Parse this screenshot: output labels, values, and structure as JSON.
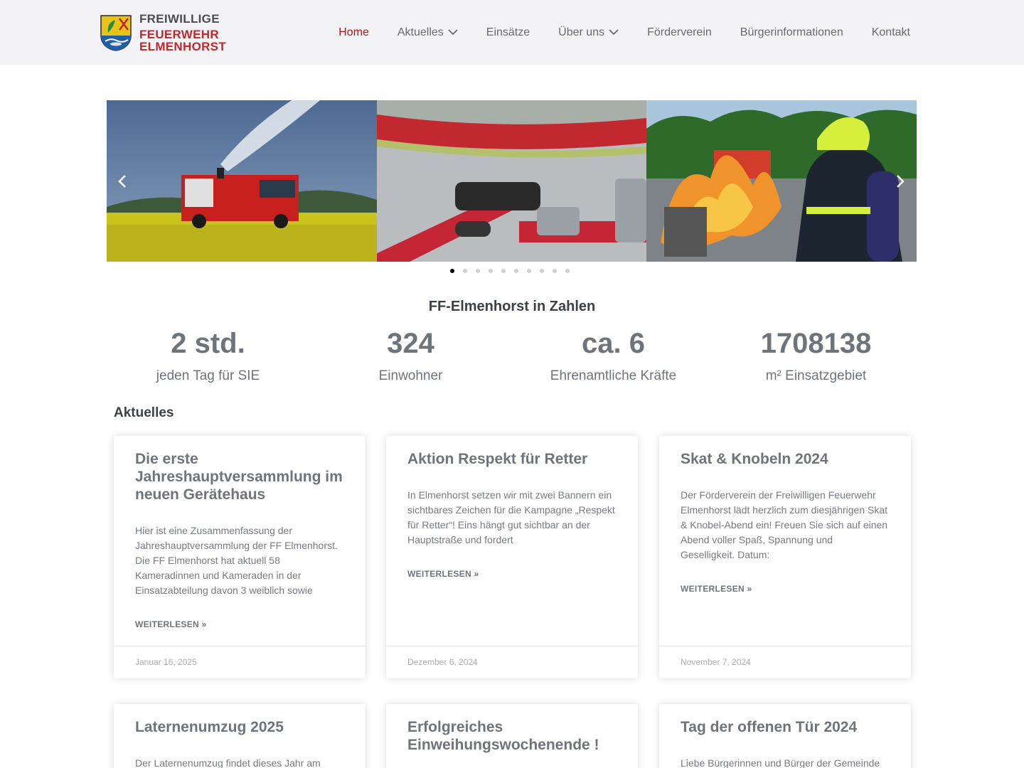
{
  "header": {
    "logo_line1": "FREIWILLIGE",
    "logo_line2": "FEUERWEHR ELMENHORST",
    "nav": [
      {
        "label": "Home",
        "active": true
      },
      {
        "label": "Aktuelles",
        "dropdown": true
      },
      {
        "label": "Einsätze"
      },
      {
        "label": "Über uns",
        "dropdown": true
      },
      {
        "label": "Förderverein"
      },
      {
        "label": "Bürgerinformationen"
      },
      {
        "label": "Kontakt"
      }
    ]
  },
  "slider": {
    "slides": [
      "fire-truck-in-field",
      "fire-hose-nozzle",
      "firefighter-at-fire-training"
    ],
    "dot_count": 10,
    "active_dot": 0
  },
  "stats": {
    "title": "FF-Elmenhorst in Zahlen",
    "items": [
      {
        "value": "2 std.",
        "label": "jeden Tag für SIE"
      },
      {
        "value": "324",
        "label": "Einwohner"
      },
      {
        "value": "ca. 6",
        "label": "Ehrenamtliche Kräfte"
      },
      {
        "value": "1708138",
        "label": "m² Einsatzgebiet"
      }
    ]
  },
  "news": {
    "title": "Aktuelles",
    "read_more": "WEITERLESEN »",
    "posts": [
      {
        "title": "Die erste Jahreshauptversammlung im neuen Gerätehaus",
        "excerpt": "Hier ist eine Zusammenfassung der Jahreshauptversammlung der FF Elmenhorst. Die FF Elmenhorst hat aktuell 58 Kameradinnen und Kameraden in der Einsatzabteilung davon 3 weiblich sowie",
        "date": "Januar 16, 2025"
      },
      {
        "title": "Aktion Respekt für Retter",
        "excerpt": "In Elmenhorst setzen wir mit zwei Bannern ein sichtbares Zeichen für die Kampagne „Respekt für Retter“!  Eins hängt gut sichtbar an der Hauptstraße und fordert",
        "date": "Dezember 6, 2024"
      },
      {
        "title": "Skat & Knobeln 2024",
        "excerpt": "Der Förderverein der Freiwilligen Feuerwehr Elmenhorst lädt herzlich zum diesjährigen Skat & Knobel-Abend ein! Freuen Sie sich auf einen Abend voller Spaß, Spannung und Geselligkeit. Datum:",
        "date": "November 7, 2024"
      },
      {
        "title": "Laternenumzug 2025",
        "excerpt": "Der Laternenumzug findet dieses Jahr am"
      },
      {
        "title": "Erfolgreiches Einweihungswochenende !",
        "excerpt": ""
      },
      {
        "title": "Tag der offenen Tür 2024",
        "excerpt": "Liebe Bürgerinnen und Bürger der Gemeinde"
      }
    ]
  }
}
